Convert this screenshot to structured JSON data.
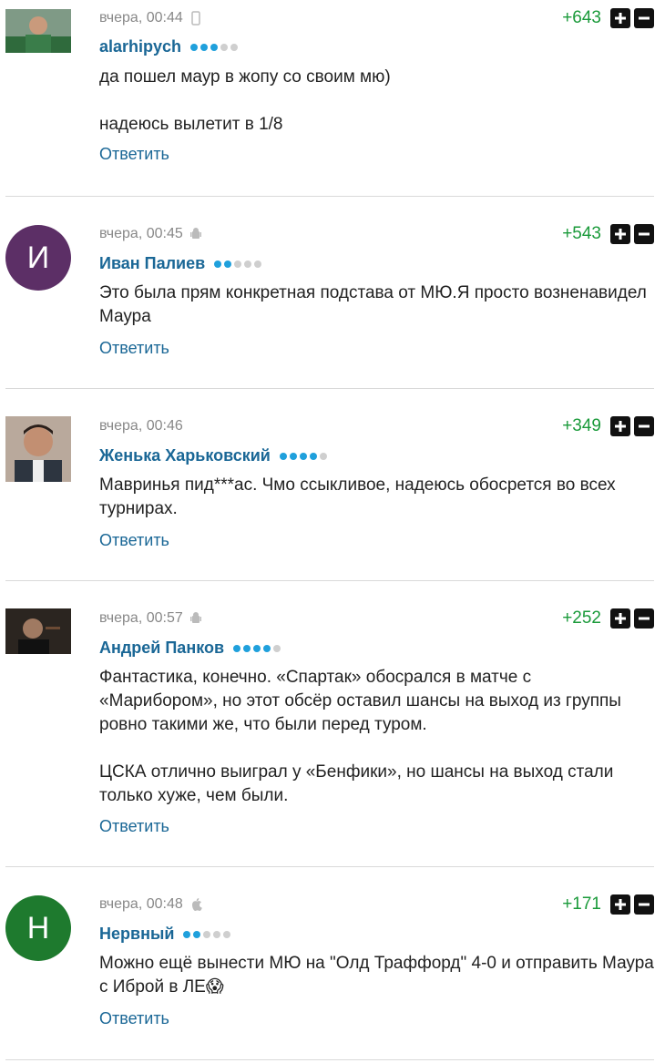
{
  "comments": [
    {
      "time": "вчера, 00:44",
      "device": "phone-icon",
      "author": "alarhipych",
      "level": 3,
      "score": "+643",
      "paragraphs": [
        "да пошел маур в жопу со своим мю)",
        "надеюсь вылетит в 1/8"
      ],
      "reply": "Ответить"
    },
    {
      "time": "вчера, 00:45",
      "device": "android-icon",
      "author": "Иван Палиев",
      "level": 2,
      "score": "+543",
      "avatar_letter": "И",
      "avatar_color": "#5c2f66",
      "paragraphs": [
        "Это была прям конкретная подстава от МЮ.Я просто возненавидел Маура"
      ],
      "reply": "Ответить"
    },
    {
      "time": "вчера, 00:46",
      "device": "",
      "author": "Женька Харьковский",
      "level": 4,
      "score": "+349",
      "paragraphs": [
        "Мавринья пид***ас. Чмо ссыкливое, надеюсь обосрется во всех турнирах."
      ],
      "reply": "Ответить"
    },
    {
      "time": "вчера, 00:57",
      "device": "android-icon",
      "author": "Андрей Панков",
      "level": 4,
      "score": "+252",
      "paragraphs": [
        "Фантастика, конечно. «Спартак» обосрался в матче с «Марибором», но этот обсёр оставил шансы на выход из группы ровно такими же, что были перед туром.",
        "ЦСКА отлично выиграл у «Бенфики», но шансы на выход стали только хуже, чем были."
      ],
      "reply": "Ответить"
    },
    {
      "time": "вчера, 00:48",
      "device": "apple-icon",
      "author": "Нервный",
      "level": 2,
      "score": "+171",
      "avatar_letter": "Н",
      "avatar_color": "#1e7a2e",
      "paragraphs": [
        "Можно ещё вынести МЮ на \"Олд Траффорд\" 4-0 и отправить Маура с Иброй в ЛЕ😱"
      ],
      "reply": "Ответить"
    }
  ],
  "vote_plus": "+",
  "vote_minus": "−"
}
